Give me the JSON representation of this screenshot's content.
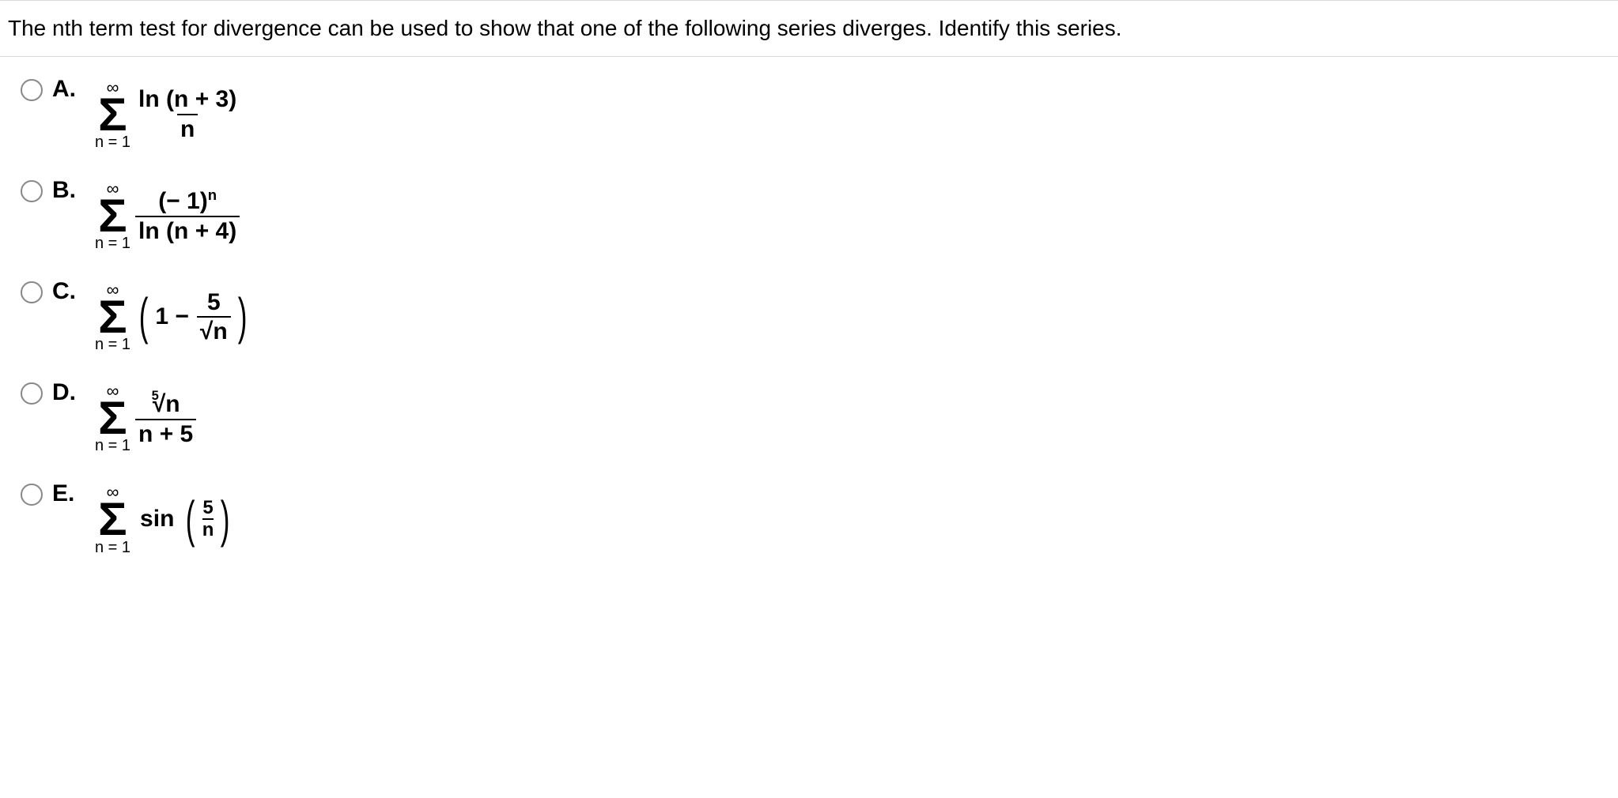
{
  "question": "The nth term test for divergence can be used to show that one of the following series diverges. Identify this series.",
  "sigma": {
    "top": "∞",
    "bottom": "n = 1"
  },
  "options": {
    "a": {
      "letter": "A.",
      "num": "ln (n + 3)",
      "den": "n"
    },
    "b": {
      "letter": "B.",
      "num_base": "(− 1)",
      "num_exp": "n",
      "den": "ln (n + 4)"
    },
    "c": {
      "letter": "C.",
      "lead": "1 −",
      "frac_num": "5",
      "frac_den": "√n"
    },
    "d": {
      "letter": "D.",
      "root_index": "5",
      "root_body": "√n",
      "den": "n + 5"
    },
    "e": {
      "letter": "E.",
      "func": "sin",
      "frac_num": "5",
      "frac_den": "n"
    }
  }
}
